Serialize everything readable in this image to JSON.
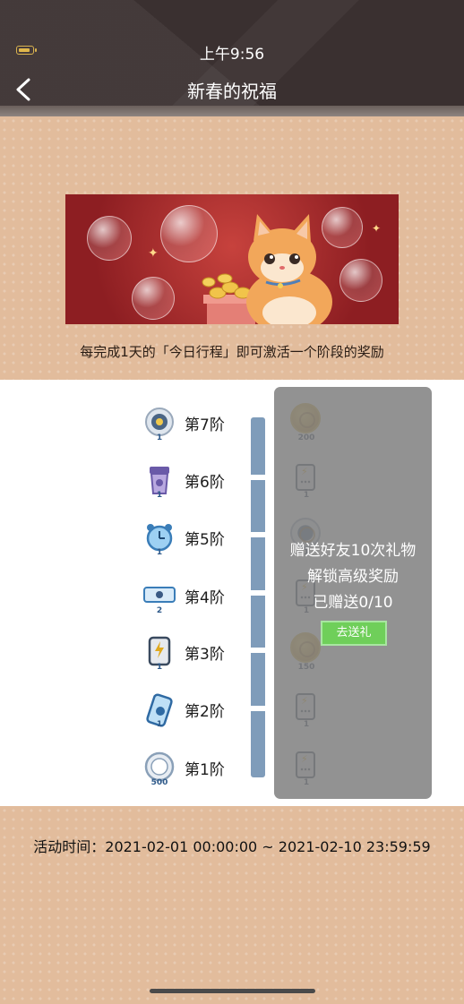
{
  "status_bar": {
    "time": "上午9:56"
  },
  "nav": {
    "title": "新春的祝福"
  },
  "banner": {
    "description": "每完成1天的「今日行程」即可激活一个阶段的奖励"
  },
  "stages": [
    {
      "label": "第7阶",
      "icon": "medal-icon",
      "count": "1"
    },
    {
      "label": "第6阶",
      "icon": "cup-icon",
      "count": "1"
    },
    {
      "label": "第5阶",
      "icon": "alarm-clock-icon",
      "count": "1"
    },
    {
      "label": "第4阶",
      "icon": "ticket-icon",
      "count": "2"
    },
    {
      "label": "第3阶",
      "icon": "power-bank-icon",
      "count": "1"
    },
    {
      "label": "第2阶",
      "icon": "phone-tag-icon",
      "count": "1"
    },
    {
      "label": "第1阶",
      "icon": "cat-coin-icon",
      "count": "500"
    }
  ],
  "rewards": [
    {
      "icon": "gold-coin-icon",
      "count": "200"
    },
    {
      "icon": "power-bank-icon",
      "count": "1"
    },
    {
      "icon": "medal-icon",
      "count": "1"
    },
    {
      "icon": "power-bank-icon",
      "count": "1"
    },
    {
      "icon": "gold-coin-icon",
      "count": "150"
    },
    {
      "icon": "power-bank-icon",
      "count": "1"
    },
    {
      "icon": "power-bank-icon",
      "count": "1"
    }
  ],
  "locked_panel": {
    "line1": "赠送好友10次礼物",
    "line2": "解锁高级奖励",
    "progress": "已赠送0/10",
    "button": "去送礼"
  },
  "activity": {
    "time_range": "活动时间：2021-02-01 00:00:00 ~ 2021-02-10 23:59:59"
  },
  "colors": {
    "header": "#3a3030",
    "page_background": "#e2bc9c",
    "track": "#7f9cba",
    "button": "#6fcf5a"
  }
}
